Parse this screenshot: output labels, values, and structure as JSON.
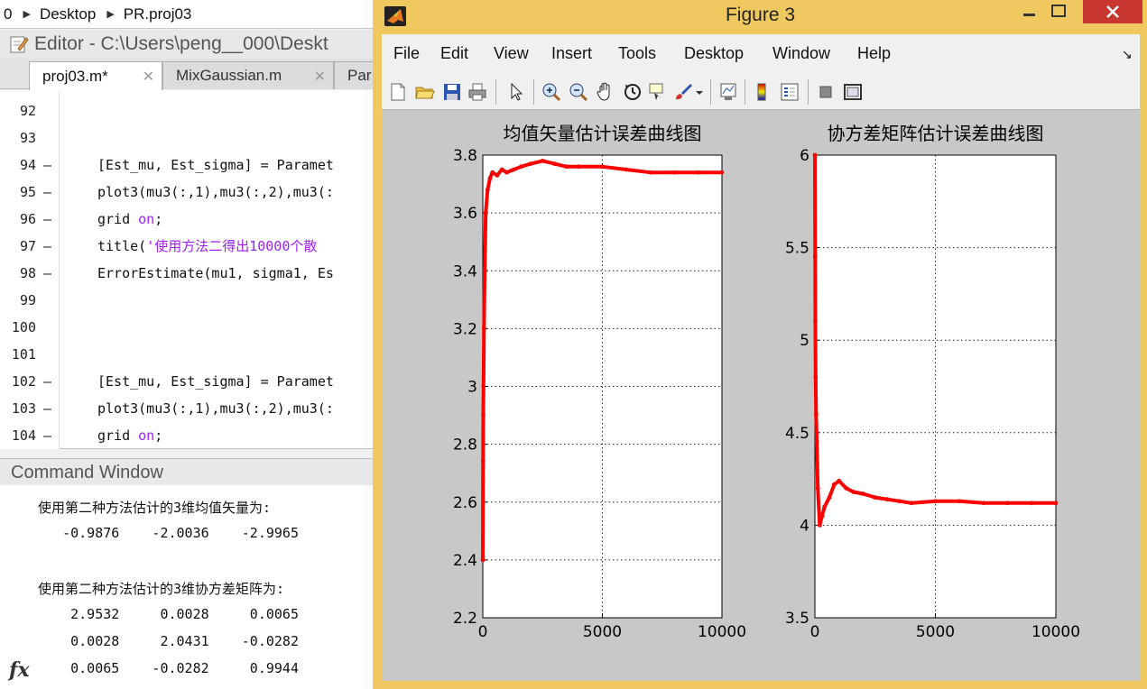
{
  "breadcrumb": {
    "items": [
      "0",
      "Desktop",
      "PR.proj03"
    ]
  },
  "editor": {
    "title": "Editor - C:\\Users\\peng__000\\Deskt",
    "tabs": [
      {
        "label": "proj03.m*",
        "close": "✕"
      },
      {
        "label": "MixGaussian.m",
        "close": "✕"
      },
      {
        "label": "Par",
        "close": ""
      }
    ],
    "lines": [
      {
        "n": "92",
        "dash": "",
        "code": ""
      },
      {
        "n": "93",
        "dash": "",
        "code": ""
      },
      {
        "n": "94",
        "dash": "—",
        "code": "[Est_mu, Est_sigma] = Paramet"
      },
      {
        "n": "95",
        "dash": "—",
        "code": "plot3(mu3(:,1),mu3(:,2),mu3(:"
      },
      {
        "n": "96",
        "dash": "—",
        "code": "grid ",
        "kw": "on",
        "tail": ";"
      },
      {
        "n": "97",
        "dash": "—",
        "code": "title(",
        "str": "'使用方法二得出10000个散"
      },
      {
        "n": "98",
        "dash": "—",
        "code": "ErrorEstimate(mu1, sigma1, Es"
      },
      {
        "n": "99",
        "dash": "",
        "code": ""
      },
      {
        "n": "100",
        "dash": "",
        "code": ""
      },
      {
        "n": "101",
        "dash": "",
        "code": ""
      },
      {
        "n": "102",
        "dash": "—",
        "code": "[Est_mu, Est_sigma] = Paramet"
      },
      {
        "n": "103",
        "dash": "—",
        "code": "plot3(mu3(:,1),mu3(:,2),mu3(:"
      },
      {
        "n": "104",
        "dash": "—",
        "code": "grid ",
        "kw": "on",
        "tail": ";"
      }
    ]
  },
  "command_window": {
    "title": "Command Window",
    "lines": [
      "使用第二种方法估计的3维均值矢量为:",
      "   -0.9876    -2.0036    -2.9965",
      "",
      "使用第二种方法估计的3维协方差矩阵为:",
      "    2.9532     0.0028     0.0065",
      "    0.0028     2.0431    -0.0282",
      "    0.0065    -0.0282     0.9944"
    ],
    "prompt": "fx"
  },
  "figure": {
    "title": "Figure 3",
    "menus": [
      "File",
      "Edit",
      "View",
      "Insert",
      "Tools",
      "Desktop",
      "Window",
      "Help"
    ],
    "dock_arrow": "↘"
  },
  "colors": {
    "series": "#ff0000",
    "window_frame": "#f0c860",
    "close_button": "#c7372f"
  },
  "chart_data": [
    {
      "type": "line",
      "title": "均值矢量估计误差曲线图",
      "xlim": [
        0,
        10000
      ],
      "ylim": [
        2.2,
        3.8
      ],
      "xticks": [
        0,
        5000,
        10000
      ],
      "yticks": [
        2.2,
        2.4,
        2.6,
        2.8,
        3,
        3.2,
        3.4,
        3.6,
        3.8
      ],
      "xtick_labels": [
        "0",
        "5000",
        "10000"
      ],
      "ytick_labels": [
        "2.2",
        "2.4",
        "2.6",
        "2.8",
        "3",
        "3.2",
        "3.4",
        "3.6",
        "3.8"
      ],
      "grid": true,
      "x": [
        1,
        10,
        20,
        30,
        50,
        80,
        120,
        200,
        300,
        400,
        600,
        800,
        1000,
        1300,
        1600,
        2000,
        2500,
        3000,
        3500,
        4000,
        5000,
        6000,
        7000,
        8000,
        9000,
        10000
      ],
      "values": [
        2.4,
        2.74,
        2.9,
        3.0,
        3.2,
        3.4,
        3.6,
        3.68,
        3.72,
        3.74,
        3.73,
        3.75,
        3.74,
        3.75,
        3.76,
        3.77,
        3.78,
        3.77,
        3.76,
        3.76,
        3.76,
        3.75,
        3.74,
        3.74,
        3.74,
        3.74
      ]
    },
    {
      "type": "line",
      "title": "协方差矩阵估计误差曲线图",
      "xlim": [
        0,
        10000
      ],
      "ylim": [
        3.5,
        6
      ],
      "xticks": [
        0,
        5000,
        10000
      ],
      "yticks": [
        3.5,
        4,
        4.5,
        5,
        5.5,
        6
      ],
      "xtick_labels": [
        "0",
        "5000",
        "10000"
      ],
      "ytick_labels": [
        "3.5",
        "4",
        "4.5",
        "5",
        "5.5",
        "6"
      ],
      "grid": true,
      "x": [
        1,
        10,
        20,
        30,
        50,
        80,
        120,
        200,
        300,
        400,
        600,
        800,
        1000,
        1300,
        1600,
        2000,
        2500,
        3000,
        3500,
        4000,
        5000,
        6000,
        7000,
        8000,
        9000,
        10000
      ],
      "values": [
        6.0,
        5.45,
        5.1,
        4.8,
        4.6,
        4.45,
        4.2,
        4.0,
        4.05,
        4.1,
        4.15,
        4.22,
        4.24,
        4.2,
        4.18,
        4.17,
        4.15,
        4.14,
        4.13,
        4.12,
        4.13,
        4.13,
        4.12,
        4.12,
        4.12,
        4.12
      ]
    }
  ]
}
